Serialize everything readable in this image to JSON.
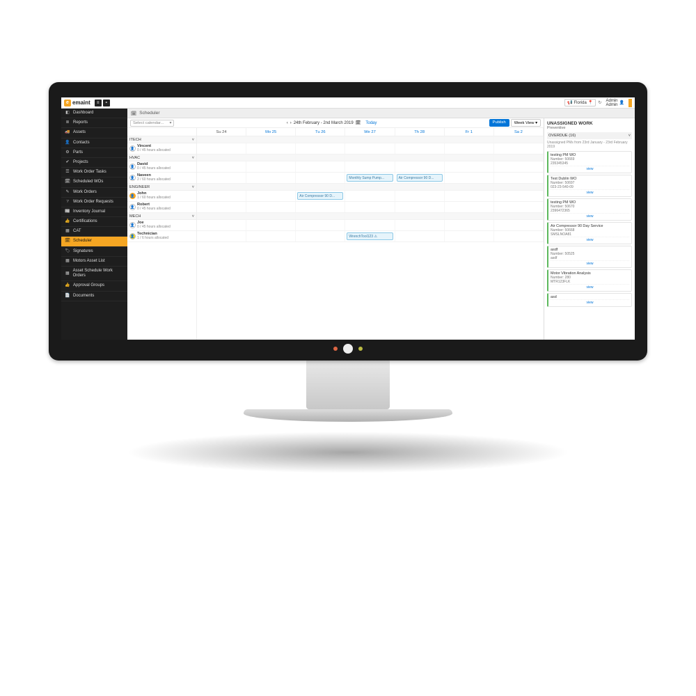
{
  "app": {
    "brand": "emaint",
    "brand_letter": "e"
  },
  "topbar": {
    "location": "Florida",
    "user_line1": "Admin",
    "user_line2": "Admin"
  },
  "sidebar": {
    "items": [
      {
        "icon": "◧",
        "label": "Dashboard"
      },
      {
        "icon": "≣",
        "label": "Reports"
      },
      {
        "icon": "🚚",
        "label": "Assets"
      },
      {
        "icon": "👤",
        "label": "Contacts"
      },
      {
        "icon": "⚙",
        "label": "Parts"
      },
      {
        "icon": "✔",
        "label": "Projects"
      },
      {
        "icon": "☰",
        "label": "Work Order Tasks"
      },
      {
        "icon": "🗓",
        "label": "Scheduled WOs"
      },
      {
        "icon": "✎",
        "label": "Work Orders"
      },
      {
        "icon": "?",
        "label": "Work Order Requests"
      },
      {
        "icon": "📰",
        "label": "Inventory Journal"
      },
      {
        "icon": "👍",
        "label": "Certifications"
      },
      {
        "icon": "▦",
        "label": "CAT"
      },
      {
        "icon": "🗓",
        "label": "Scheduler",
        "active": true
      },
      {
        "icon": "🏷",
        "label": "Signatures"
      },
      {
        "icon": "▦",
        "label": "Motors Asset List"
      },
      {
        "icon": "▦",
        "label": "Asset Schedule Work Orders"
      },
      {
        "icon": "👍",
        "label": "Approval Groups"
      },
      {
        "icon": "📄",
        "label": "Documents"
      }
    ]
  },
  "breadcrumb": {
    "icon": "🗓",
    "title": "Scheduler"
  },
  "calendar": {
    "select_placeholder": "Select calendar...",
    "date_range": "24th February - 2nd March 2019",
    "today_label": "Today",
    "publish_label": "Publish",
    "view_label": "Week View ▾",
    "days": [
      "Su 24",
      "Mo 25",
      "Tu 26",
      "We 27",
      "Th 28",
      "Fr 1",
      "Sa 2"
    ]
  },
  "resources": [
    {
      "type": "group",
      "label": "ITECH"
    },
    {
      "type": "person",
      "name": "Vincent",
      "alloc": "0 / 45 hours allocated"
    },
    {
      "type": "group",
      "label": "HVAC"
    },
    {
      "type": "person",
      "name": "David",
      "alloc": "0 / 45 hours allocated"
    },
    {
      "type": "person",
      "name": "Naveen",
      "alloc": "2 / 60 hours allocated"
    },
    {
      "type": "group",
      "label": "ENGINEER"
    },
    {
      "type": "person",
      "name": "John",
      "alloc": "1 / 60 hours allocated",
      "color": true
    },
    {
      "type": "person",
      "name": "Robert",
      "alloc": "0 / 45 hours allocated"
    },
    {
      "type": "group",
      "label": "MECH"
    },
    {
      "type": "person",
      "name": "Joe",
      "alloc": "0 / 45 hours allocated"
    },
    {
      "type": "person",
      "name": "Technician",
      "alloc": "1 / 6 hours allocated",
      "yellow": true
    }
  ],
  "events": [
    {
      "row": 4,
      "day": 3,
      "label": "Monthly Sump Pump..."
    },
    {
      "row": 4,
      "day": 4,
      "label": "Air Compressor 90 D..."
    },
    {
      "row": 6,
      "day": 2,
      "label": "Air Compressor 90 D..."
    },
    {
      "row": 10,
      "day": 3,
      "label": "WrenchTool123    ⚠"
    }
  ],
  "right_panel": {
    "title": "UNASSIGNED WORK",
    "subtitle": "Preventive",
    "overdue_label": "OVERDUE (16)",
    "range": "Unassigned PMs from 23rd January - 23rd February 2019",
    "cards": [
      {
        "title": "testing PM WO",
        "num": "Number: 50669",
        "code": "235345345"
      },
      {
        "title": "Test Dublin WO",
        "num": "Number: 50697",
        "code": "023-23-540-09"
      },
      {
        "title": "testing PM WO",
        "num": "Number: 50670",
        "code": "2396472365"
      },
      {
        "title": "Air Compressor 90 Day Service",
        "num": "Number: 50668",
        "code": "SMSLNOA81"
      },
      {
        "title": "asdf",
        "num": "Number: 50525",
        "code": "asdf"
      },
      {
        "title": "Motor Vibration Analysis",
        "num": "Number: 280",
        "code": "MTR123FLK"
      },
      {
        "title": "asd",
        "num": "",
        "code": ""
      }
    ],
    "view_label": "view"
  }
}
